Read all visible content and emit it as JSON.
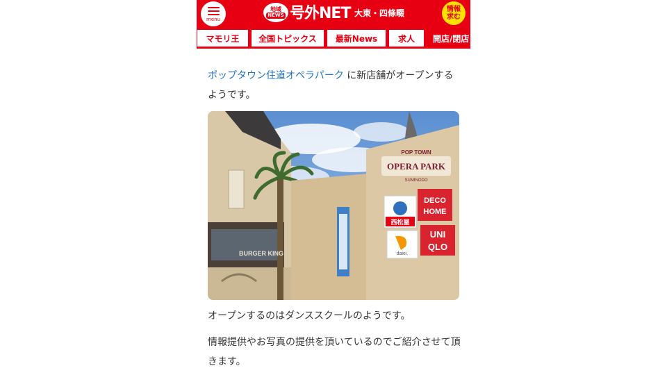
{
  "header": {
    "menu_label": "menu",
    "badge_line1": "地域",
    "badge_line2": "NEWS",
    "logo": "号外NET",
    "area": "大東・四條畷",
    "info_line1": "情報",
    "info_line2": "求む"
  },
  "nav": {
    "tabs": [
      "マモリ王",
      "全国トピックス",
      "最新News",
      "求人",
      "開店/閉店"
    ]
  },
  "article": {
    "link_text": "ポップタウン住道オペラパーク",
    "intro_rest": " に新店舗がオープンするようです。",
    "photo": {
      "sign_arch": "POP TOWN",
      "sign_main": "OPERA PARK",
      "sign_sub": "SUMINODO",
      "store1": "西松屋",
      "store2_line1": "DECO",
      "store2_line2": "HOME",
      "store3": "daiei.",
      "store4_line1": "UNI",
      "store4_line2": "QLO",
      "building_sign": "BURGER KING"
    },
    "para2": "オープンするのはダンススクールのようです。",
    "para3": "情報提供やお写真の提供を頂いているのでご紹介させて頂きます。"
  },
  "colors": {
    "brand_red": "#e60012",
    "accent_yellow": "#ffe000",
    "link_blue": "#1f73c4"
  }
}
